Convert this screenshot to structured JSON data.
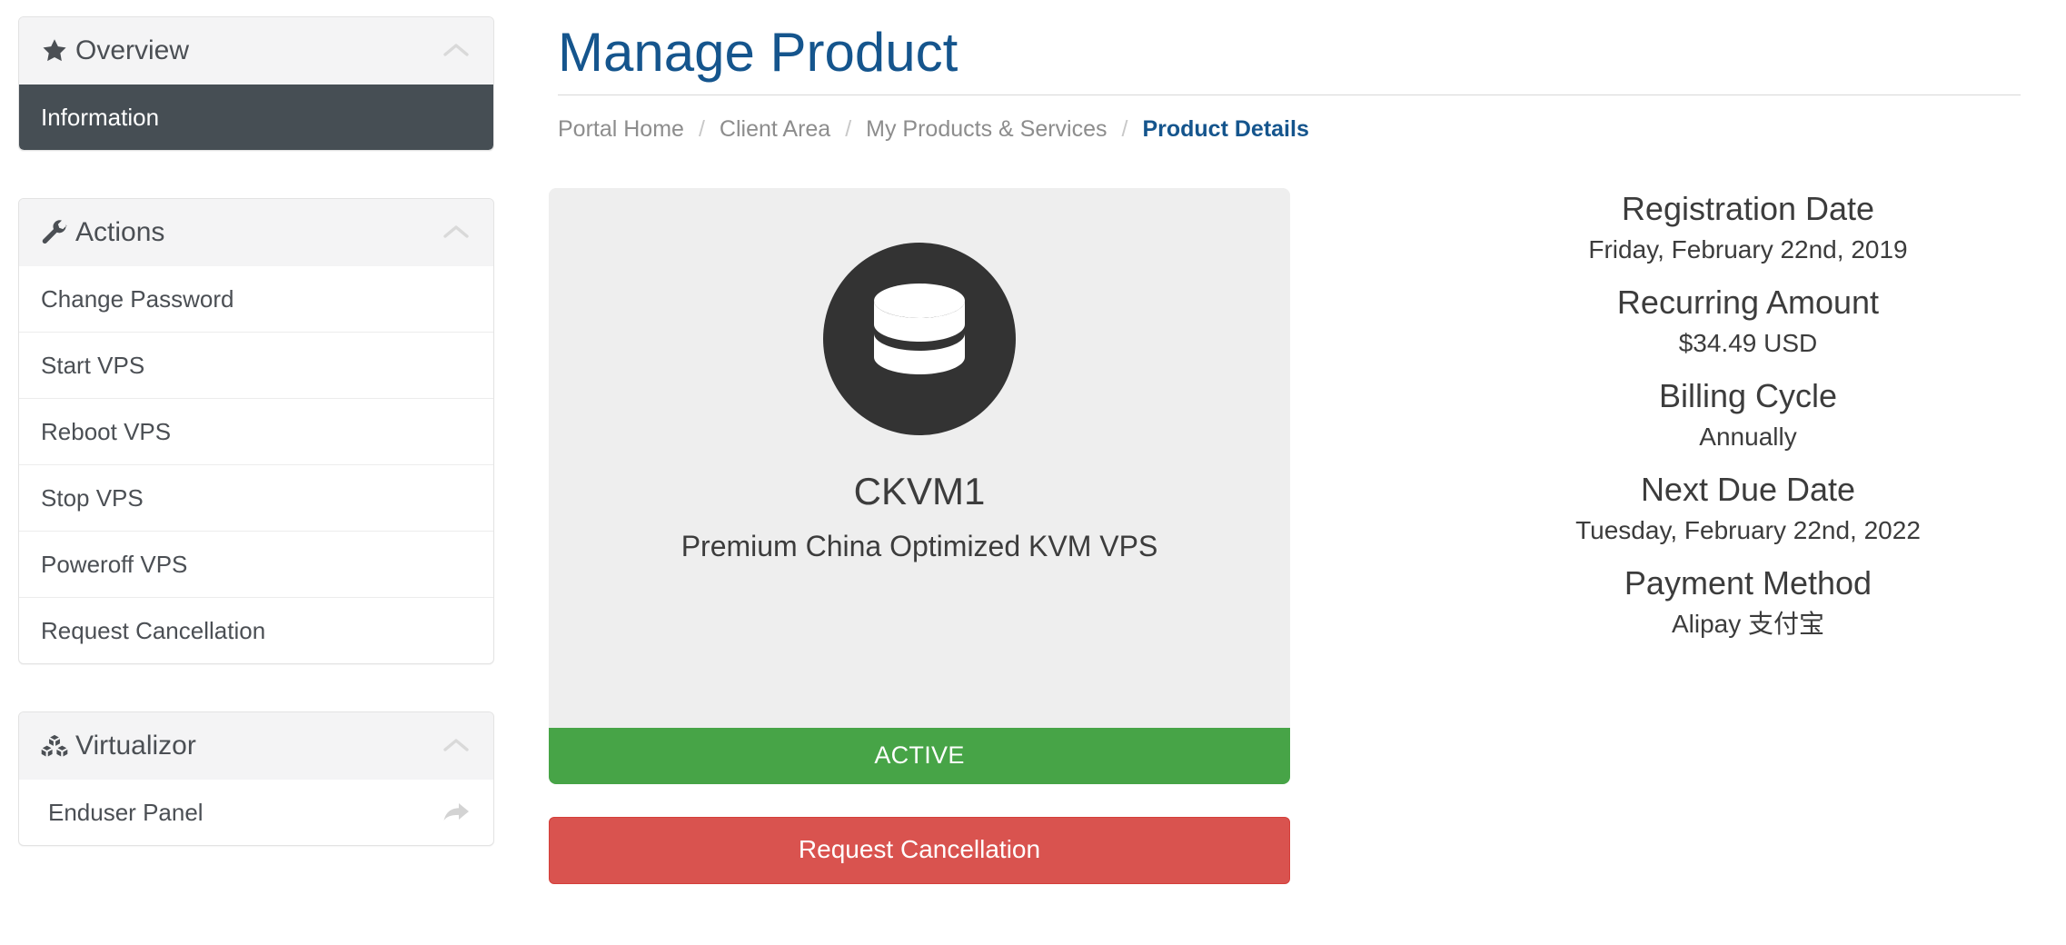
{
  "header": {
    "title": "Manage Product",
    "breadcrumb": [
      {
        "label": "Portal Home",
        "current": false
      },
      {
        "label": "Client Area",
        "current": false
      },
      {
        "label": "My Products & Services",
        "current": false
      },
      {
        "label": "Product Details",
        "current": true
      }
    ],
    "separator": "/"
  },
  "sidebar": {
    "panels": [
      {
        "title": "Overview",
        "icon": "star-icon",
        "collapse_icon": "chevron-up-icon",
        "items": [
          {
            "label": "Information",
            "active": true,
            "icon": null
          }
        ]
      },
      {
        "title": "Actions",
        "icon": "wrench-icon",
        "collapse_icon": "chevron-up-icon",
        "items": [
          {
            "label": "Change Password",
            "active": false,
            "icon": null
          },
          {
            "label": "Start VPS",
            "active": false,
            "icon": null
          },
          {
            "label": "Reboot VPS",
            "active": false,
            "icon": null
          },
          {
            "label": "Stop VPS",
            "active": false,
            "icon": null
          },
          {
            "label": "Poweroff VPS",
            "active": false,
            "icon": null
          },
          {
            "label": "Request Cancellation",
            "active": false,
            "icon": null
          }
        ]
      },
      {
        "title": "Virtualizor",
        "icon": "cubes-icon",
        "collapse_icon": "chevron-up-icon",
        "items": [
          {
            "label": "Enduser Panel",
            "active": false,
            "icon": "external-link-arrow-icon"
          }
        ]
      }
    ]
  },
  "product": {
    "avatar_icon": "database-icon",
    "name": "CKVM1",
    "description": "Premium China Optimized KVM VPS",
    "status": "ACTIVE",
    "status_color": "#47a447",
    "cancel_button": "Request Cancellation",
    "cancel_button_color": "#d9534f"
  },
  "details": [
    {
      "label": "Registration Date",
      "value": "Friday, February 22nd, 2019"
    },
    {
      "label": "Recurring Amount",
      "value": "$34.49 USD"
    },
    {
      "label": "Billing Cycle",
      "value": "Annually"
    },
    {
      "label": "Next Due Date",
      "value": "Tuesday, February 22nd, 2022"
    },
    {
      "label": "Payment Method",
      "value": "Alipay 支付宝"
    }
  ],
  "colors": {
    "title_blue": "#15558d",
    "active_item_bg": "#464e54",
    "panel_heading_bg": "#f4f4f5",
    "card_bg": "#eeeeee",
    "avatar_bg": "#333333"
  }
}
